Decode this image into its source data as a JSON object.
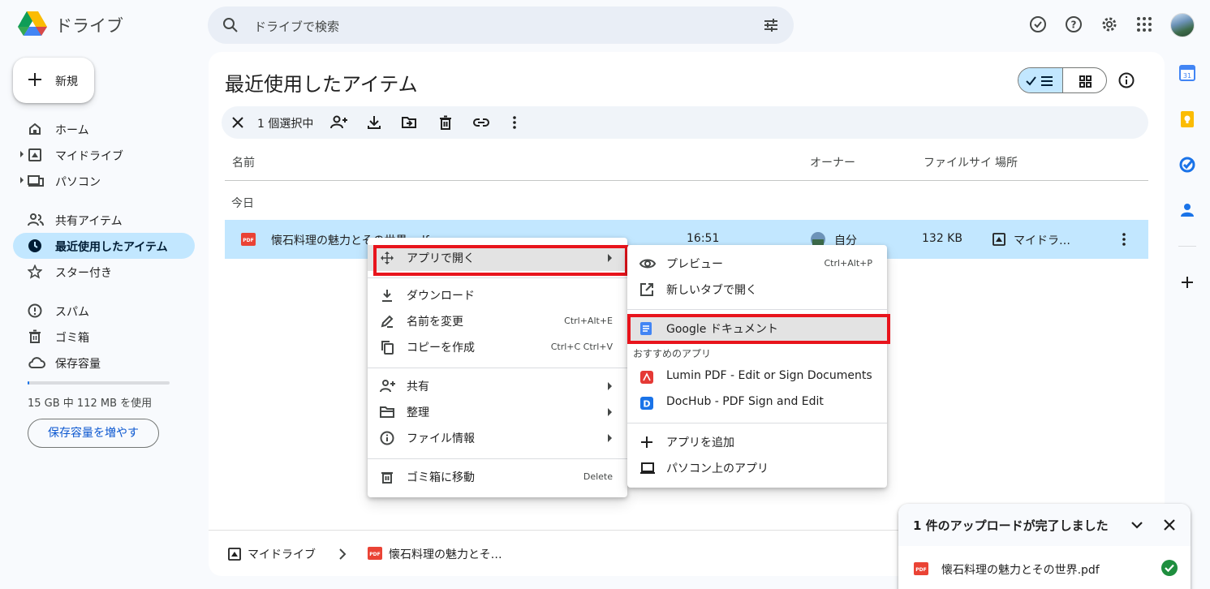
{
  "app": {
    "name": "ドライブ"
  },
  "search": {
    "placeholder": "ドライブで検索"
  },
  "new_button": {
    "label": "新規"
  },
  "sidebar": {
    "items": [
      {
        "label": "ホーム",
        "icon": "home-icon"
      },
      {
        "label": "マイドライブ",
        "icon": "my-drive-icon"
      },
      {
        "label": "パソコン",
        "icon": "computers-icon"
      },
      {
        "label": "共有アイテム",
        "icon": "shared-icon"
      },
      {
        "label": "最近使用したアイテム",
        "icon": "clock-icon",
        "active": true
      },
      {
        "label": "スター付き",
        "icon": "star-icon"
      },
      {
        "label": "スパム",
        "icon": "spam-icon"
      },
      {
        "label": "ゴミ箱",
        "icon": "trash-icon"
      },
      {
        "label": "保存容量",
        "icon": "cloud-icon"
      }
    ],
    "storage_text": "15 GB 中 112 MB を使用",
    "storage_used_fraction": 0.007,
    "storage_button": "保存容量を増やす"
  },
  "main": {
    "title": "最近使用したアイテム",
    "selection": {
      "count_label": "1 個選択中"
    },
    "columns": {
      "name": "名前",
      "owner": "オーナー",
      "size": "ファイルサイ",
      "location": "場所"
    },
    "group_label": "今日",
    "file": {
      "name": "懐石料理の魅力とその世界.pdf",
      "time": "16:51",
      "owner": "自分",
      "size": "132 KB",
      "location": "マイドラ…"
    },
    "breadcrumb": {
      "root": "マイドライブ",
      "file": "懐石料理の魅力とそ…"
    }
  },
  "context_menu": {
    "items": [
      {
        "label": "アプリで開く",
        "icon": "open-with-icon",
        "submenu": true
      },
      {
        "label": "ダウンロード",
        "icon": "download-icon"
      },
      {
        "label": "名前を変更",
        "icon": "rename-icon",
        "shortcut": "Ctrl+Alt+E"
      },
      {
        "label": "コピーを作成",
        "icon": "copy-icon",
        "shortcut": "Ctrl+C Ctrl+V"
      },
      {
        "label": "共有",
        "icon": "share-icon",
        "submenu": true
      },
      {
        "label": "整理",
        "icon": "folder-icon",
        "submenu": true
      },
      {
        "label": "ファイル情報",
        "icon": "info-icon",
        "submenu": true
      },
      {
        "label": "ゴミ箱に移動",
        "icon": "trash-icon",
        "shortcut": "Delete"
      }
    ]
  },
  "open_with_menu": {
    "preview": {
      "label": "プレビュー",
      "shortcut": "Ctrl+Alt+P"
    },
    "new_tab": {
      "label": "新しいタブで開く"
    },
    "google_docs": {
      "label": "Google ドキュメント"
    },
    "suggested_header": "おすすめのアプリ",
    "suggested": [
      {
        "label": "Lumin PDF - Edit or Sign Documents",
        "color": "#e53935"
      },
      {
        "label": "DocHub - PDF Sign and Edit",
        "color": "#1a73e8"
      }
    ],
    "add_app": {
      "label": "アプリを追加"
    },
    "desktop_apps": {
      "label": "パソコン上のアプリ"
    }
  },
  "upload_toast": {
    "title": "1 件のアップロードが完了しました",
    "file": "懐石料理の魅力とその世界.pdf"
  },
  "colors": {
    "accent": "#0b57d0",
    "selected_row": "#c2e7ff",
    "highlight_box": "#e8141c",
    "pdf_red": "#ea4335",
    "success_green": "#1e8e3e"
  }
}
